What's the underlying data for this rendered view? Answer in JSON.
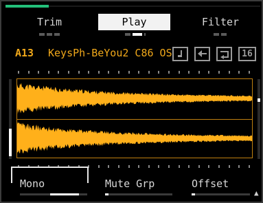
{
  "progress": {
    "value": 0.17,
    "color": "#23c07a"
  },
  "tabs": [
    {
      "label": "Trim",
      "active": false
    },
    {
      "label": "Play",
      "active": true
    },
    {
      "label": "Filter",
      "active": false
    }
  ],
  "sample": {
    "number": "A13",
    "name": "KeysPh-BeYou2 C86 OS",
    "color": "#f0a81a"
  },
  "buttons": {
    "note_icon": "note-icon",
    "reverse_icon": "reverse-arrow-icon",
    "loop_icon": "loop-icon",
    "sixteen_label": "16"
  },
  "waveform": {
    "color": "#ffb01a",
    "channels": 2
  },
  "params": [
    {
      "label": "Mono",
      "selected": true,
      "level": 0.5
    },
    {
      "label": "Mute Grp",
      "selected": false,
      "level": 0.0
    },
    {
      "label": "Offset",
      "selected": false,
      "level": 0.0
    }
  ],
  "scroll_icon": "arrow-up-icon"
}
